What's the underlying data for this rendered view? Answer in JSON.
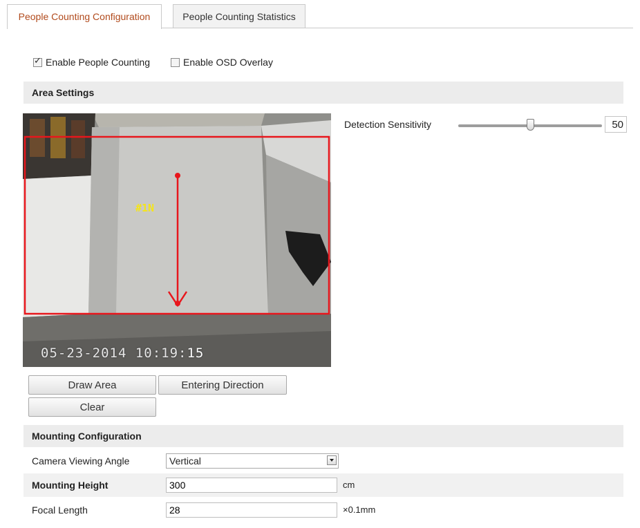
{
  "tabs": {
    "config": "People Counting Configuration",
    "statistics": "People Counting Statistics"
  },
  "options": {
    "enable_counting": {
      "label": "Enable People Counting",
      "checked": true
    },
    "enable_osd": {
      "label": "Enable OSD Overlay",
      "checked": false
    }
  },
  "area_settings": {
    "title": "Area Settings",
    "video": {
      "timestamp_main": "05-23-2014 10:19:",
      "timestamp_sec": "15",
      "area_label": "#1N"
    },
    "buttons": {
      "draw_area": "Draw Area",
      "entering_direction": "Entering Direction",
      "clear": "Clear"
    },
    "sensitivity": {
      "label": "Detection Sensitivity",
      "value": "50",
      "fraction": 0.5
    }
  },
  "mounting": {
    "title": "Mounting Configuration",
    "viewing_angle": {
      "label": "Camera Viewing Angle",
      "value": "Vertical"
    },
    "height": {
      "label": "Mounting Height",
      "value": "300",
      "unit": "cm"
    },
    "focal_length": {
      "label": "Focal Length",
      "value": "28",
      "unit": "×0.1mm"
    }
  },
  "colors": {
    "active_tab_text": "#b14a1c",
    "detection_region": "#e8161c",
    "area_label": "#f5e51a"
  }
}
